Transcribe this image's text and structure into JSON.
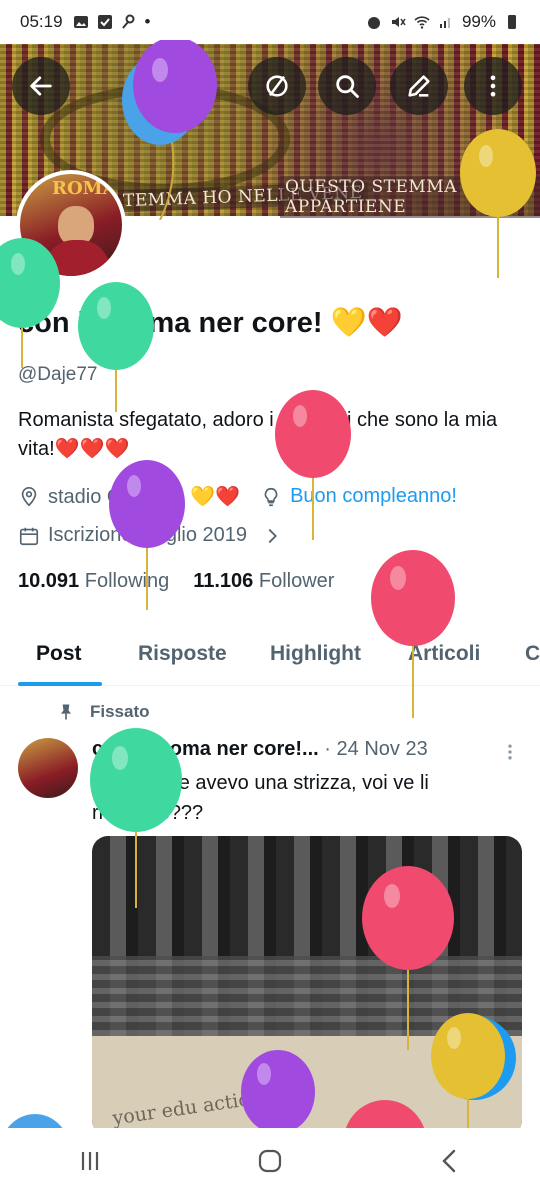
{
  "status_bar": {
    "time": "05:19",
    "battery": "99%"
  },
  "banner": {
    "sign_left": "TEMMA HO NELLE VENE",
    "sign_right": "QUESTO STEMMA MI APPARTIENE"
  },
  "header_buttons": [
    "back-icon",
    "no-sign-icon",
    "search-icon",
    "edit-icon",
    "more-icon"
  ],
  "avatar": {
    "title": "ROMA"
  },
  "profile": {
    "display_name": "con la Roma ner core! 💛❤️",
    "handle": "@Daje77",
    "bio": "Romanista sfegatato, adoro i miei figli che sono la mia vita!❤️❤️❤️",
    "location": "stadio Olimpico 💛❤️",
    "birthday": "Buon compleanno!",
    "joined": "Iscrizione: Luglio 2019"
  },
  "counts": {
    "following_count": "10.091",
    "following_label": "Following",
    "followers_count": "11.106",
    "followers_label": "Follower"
  },
  "tabs": [
    "Post",
    "Risposte",
    "Highlight",
    "Articoli",
    "C"
  ],
  "pinned_label": "Fissato",
  "post": {
    "author": "con la Roma ner core!...",
    "date": "· 24 Nov 23",
    "text": "Come no e avevo una strizza, voi ve li ricordate???",
    "image_watermark": "your edu actio"
  },
  "fab_label": "+",
  "colors": {
    "accent": "#1d9bf0",
    "text": "#0f1419",
    "secondary_text": "#536471"
  }
}
